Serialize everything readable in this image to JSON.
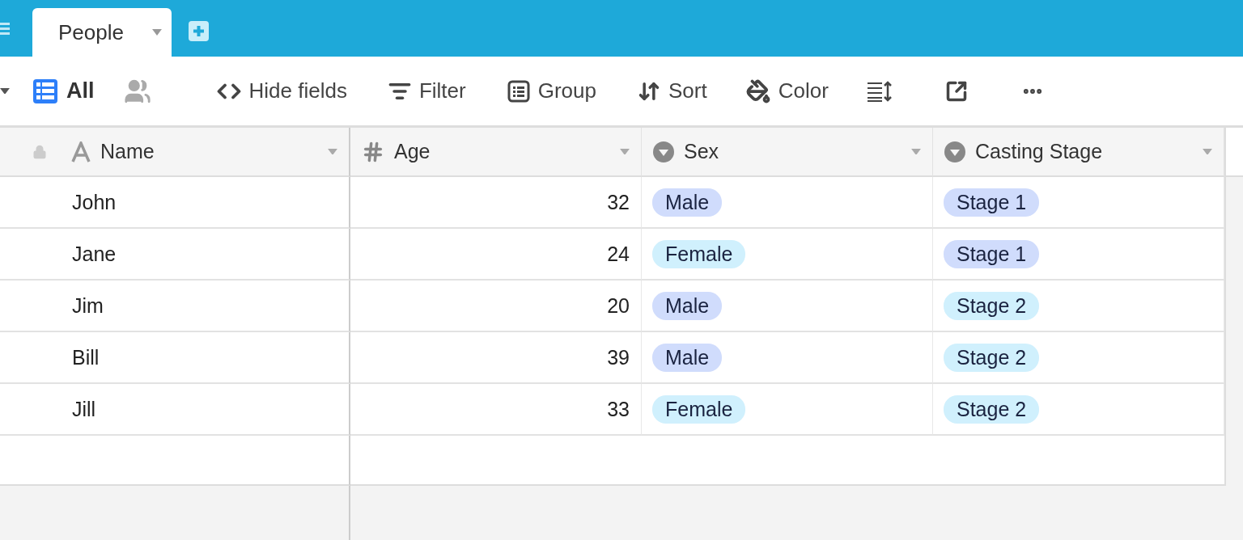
{
  "tabs": [
    {
      "label": "People",
      "selected": true
    }
  ],
  "toolbar": {
    "view": "All",
    "buttons": [
      {
        "kind": "hide",
        "label": "Hide fields"
      },
      {
        "kind": "filter",
        "label": "Filter"
      },
      {
        "kind": "group",
        "label": "Group"
      },
      {
        "kind": "sort",
        "label": "Sort"
      },
      {
        "kind": "color",
        "label": "Color"
      },
      {
        "kind": "row-height"
      },
      {
        "kind": "share"
      },
      {
        "kind": "more"
      }
    ]
  },
  "table": {
    "columns": [
      {
        "name": "Name",
        "kind": "text"
      },
      {
        "name": "Age",
        "kind": "number"
      },
      {
        "name": "Sex",
        "kind": "select"
      },
      {
        "name": "Casting Stage",
        "kind": "select"
      }
    ],
    "rows": [
      {
        "cells": [
          "John",
          "32",
          {
            "label": "Male",
            "color": "#d0dcfc"
          },
          {
            "label": "Stage 1",
            "color": "#d0dcfc"
          }
        ]
      },
      {
        "cells": [
          "Jane",
          "24",
          {
            "label": "Female",
            "color": "#d0f0fd"
          },
          {
            "label": "Stage 1",
            "color": "#d0dcfc"
          }
        ]
      },
      {
        "cells": [
          "Jim",
          "20",
          {
            "label": "Male",
            "color": "#d0dcfc"
          },
          {
            "label": "Stage 2",
            "color": "#d0f0fd"
          }
        ]
      },
      {
        "cells": [
          "Bill",
          "39",
          {
            "label": "Male",
            "color": "#d0dcfc"
          },
          {
            "label": "Stage 2",
            "color": "#d0f0fd"
          }
        ]
      },
      {
        "cells": [
          "Jill",
          "33",
          {
            "label": "Female",
            "color": "#d0f0fd"
          },
          {
            "label": "Stage 2",
            "color": "#d0f0fd"
          }
        ]
      }
    ]
  }
}
